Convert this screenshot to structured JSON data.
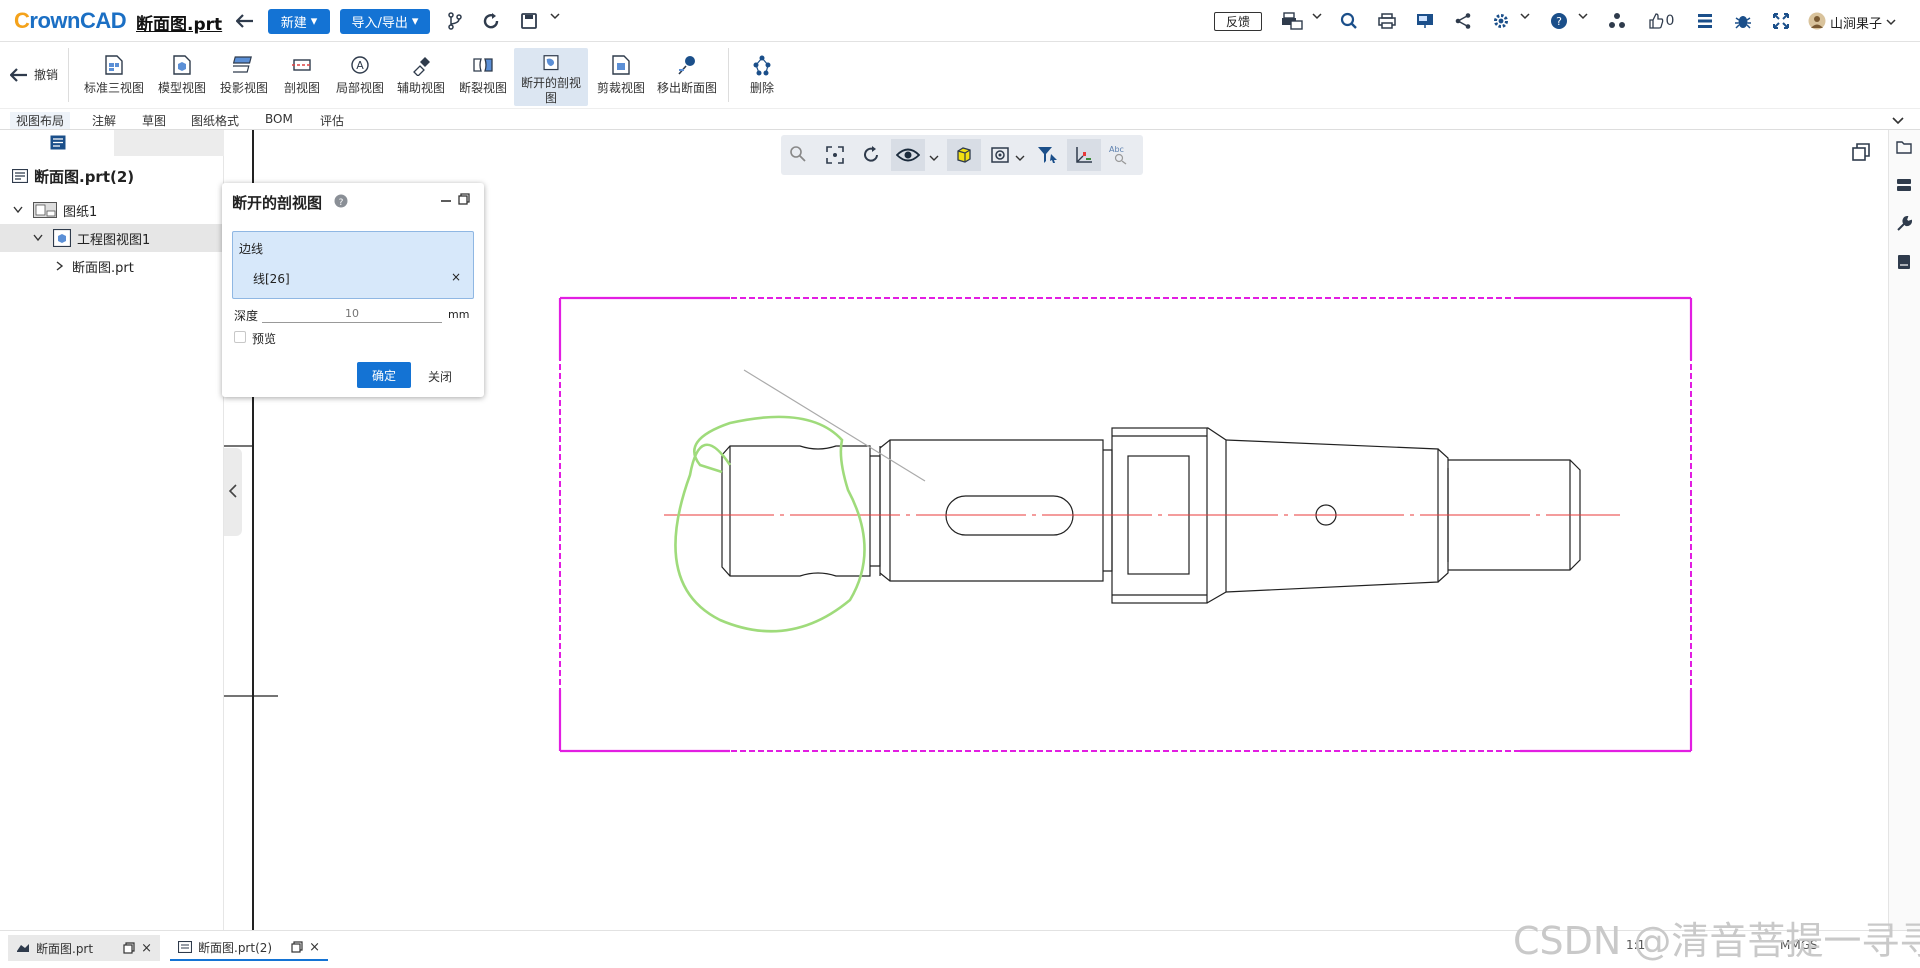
{
  "app": {
    "logo": "CrownCAD",
    "file_name": "断面图.prt"
  },
  "topbar": {
    "new_label": "新建",
    "import_export_label": "导入/导出",
    "feedback_label": "反馈",
    "like_count": "0",
    "user_name": "山涧果子"
  },
  "ribbon": {
    "undo_label": "撤销",
    "items": [
      {
        "label": "标准三视图",
        "icon": "standard-views-icon"
      },
      {
        "label": "模型视图",
        "icon": "model-view-icon"
      },
      {
        "label": "投影视图",
        "icon": "projected-view-icon"
      },
      {
        "label": "剖视图",
        "icon": "section-view-icon"
      },
      {
        "label": "局部视图",
        "icon": "detail-view-icon"
      },
      {
        "label": "辅助视图",
        "icon": "auxiliary-view-icon"
      },
      {
        "label": "断裂视图",
        "icon": "broken-view-icon"
      },
      {
        "label": "断开的剖视图",
        "icon": "broken-out-section-icon"
      },
      {
        "label": "剪裁视图",
        "icon": "crop-view-icon"
      },
      {
        "label": "移出断面图",
        "icon": "removed-section-icon"
      },
      {
        "label": "删除",
        "icon": "delete-icon"
      }
    ],
    "tabs": [
      "视图布局",
      "注解",
      "草图",
      "图纸格式",
      "BOM",
      "评估"
    ]
  },
  "tree": {
    "root": "断面图.prt(2)",
    "sheet": "图纸1",
    "view": "工程图视图1",
    "part": "断面图.prt"
  },
  "dialog": {
    "title": "断开的剖视图",
    "edge_label": "边线",
    "selected_edge": "线[26]",
    "depth_label": "深度",
    "depth_placeholder": "10",
    "depth_unit": "mm",
    "preview_label": "预览",
    "ok_label": "确定",
    "close_label": "关闭"
  },
  "bottom": {
    "tabs": [
      {
        "label": "断面图.prt",
        "active": false
      },
      {
        "label": "断面图.prt(2)",
        "active": true
      }
    ],
    "scale": "1:1",
    "units": "MMGS",
    "watermark": "CSDN @清音菩提一寻寻"
  },
  "colors": {
    "accent": "#1473d4",
    "frame": "#e21ee2",
    "centerline": "#e83a3a",
    "sketch": "#8fd66c"
  }
}
